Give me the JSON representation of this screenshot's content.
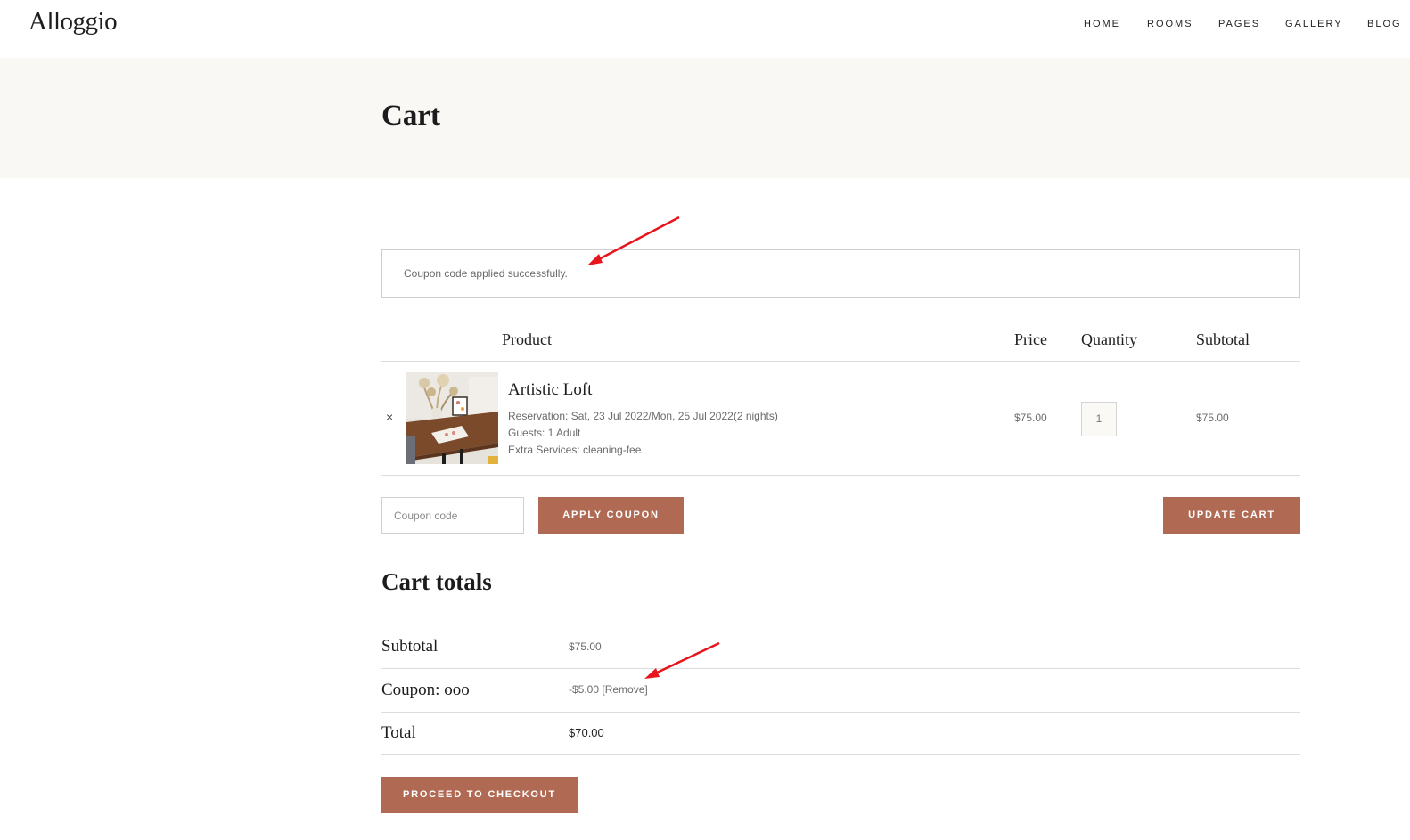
{
  "header": {
    "logo": "Alloggio",
    "nav": [
      "HOME",
      "ROOMS",
      "PAGES",
      "GALLERY",
      "BLOG"
    ]
  },
  "page": {
    "title": "Cart"
  },
  "notice": {
    "text": "Coupon code applied successfully."
  },
  "table": {
    "headers": {
      "product": "Product",
      "price": "Price",
      "quantity": "Quantity",
      "subtotal": "Subtotal"
    },
    "items": [
      {
        "remove": "×",
        "name": "Artistic Loft",
        "reservation": "Reservation: Sat, 23 Jul 2022/Mon, 25 Jul 2022(2 nights)",
        "guests": "Guests: 1 Adult",
        "extras": "Extra Services: cleaning-fee",
        "price": "$75.00",
        "quantity": "1",
        "subtotal": "$75.00"
      }
    ]
  },
  "coupon": {
    "placeholder": "Coupon code",
    "apply_label": "APPLY COUPON",
    "update_label": "UPDATE CART"
  },
  "totals": {
    "title": "Cart totals",
    "subtotal_label": "Subtotal",
    "subtotal_value": "$75.00",
    "coupon_label": "Coupon: ooo",
    "coupon_value": "-$5.00",
    "coupon_remove": "[Remove]",
    "total_label": "Total",
    "total_value": "$70.00",
    "checkout_label": "PROCEED TO CHECKOUT"
  },
  "colors": {
    "accent": "#b06a54",
    "band": "#f9f8f5",
    "annotation_arrow": "#e8141c"
  }
}
